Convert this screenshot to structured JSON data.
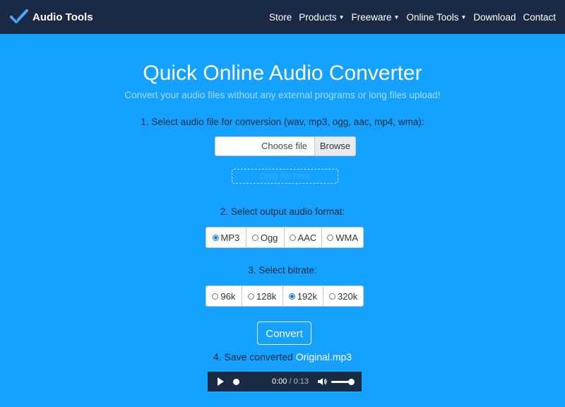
{
  "brand": {
    "name": "Audio Tools"
  },
  "nav": [
    {
      "label": "Store",
      "dropdown": false
    },
    {
      "label": "Products",
      "dropdown": true
    },
    {
      "label": "Freeware",
      "dropdown": true
    },
    {
      "label": "Online Tools",
      "dropdown": true
    },
    {
      "label": "Download",
      "dropdown": false
    },
    {
      "label": "Contact",
      "dropdown": false
    }
  ],
  "page": {
    "title": "Quick Online Audio Converter",
    "subtitle": "Convert your audio files without any external programs or long files upload!"
  },
  "step1": {
    "label": "1. Select audio file for conversion (wav, mp3, ogg, aac, mp4, wma):",
    "choose_file": "Choose file",
    "browse": "Browse",
    "drop": "Drop file here"
  },
  "step2": {
    "label": "2. Select output audio format:",
    "options": [
      "MP3",
      "Ogg",
      "AAC",
      "WMA"
    ],
    "selected": "MP3"
  },
  "step3": {
    "label": "3. Select bitrate:",
    "options": [
      "96k",
      "128k",
      "192k",
      "320k"
    ],
    "selected": "192k"
  },
  "convert": {
    "label": "Convert"
  },
  "step4": {
    "label_prefix": "4. Save converted",
    "file_link": "Original.mp3"
  },
  "player": {
    "current_time": "0:00",
    "separator": "/",
    "duration": "0:13",
    "progress": 0.0,
    "volume": 1.0
  },
  "colors": {
    "background": "#14a1ff",
    "navbar": "#1b2a44",
    "player": "#1a2a42",
    "radio_selected": "#1a73e8"
  }
}
